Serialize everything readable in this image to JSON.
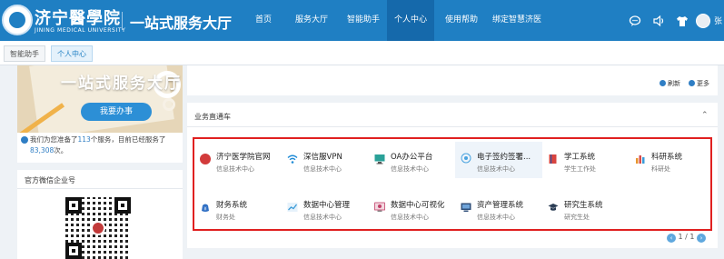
{
  "header": {
    "school_name_cn": "济宁醫學院",
    "school_name_en": "JINING MEDICAL UNIVERSITY",
    "site_title": "一站式服务大厅",
    "nav": [
      {
        "label": "首页"
      },
      {
        "label": "服务大厅"
      },
      {
        "label": "智能助手"
      },
      {
        "label": "个人中心",
        "active": true
      },
      {
        "label": "使用帮助"
      },
      {
        "label": "绑定智慧济医"
      }
    ],
    "icons": [
      "chat-icon",
      "volume-icon",
      "shirt-icon",
      "avatar"
    ],
    "username": "张"
  },
  "tabs": [
    {
      "label": "智能助手"
    },
    {
      "label": "个人中心",
      "active": true
    }
  ],
  "banner": {
    "title": "一站式服务大厅",
    "button": "我要办事"
  },
  "stats": {
    "prefix": "我们为您准备了",
    "services": "113",
    "middle": "个服务，目前已经服务了",
    "served": "83,308",
    "suffix": "次。"
  },
  "wechat": {
    "title": "官方微信企业号"
  },
  "top_card": {
    "refresh": "刷新",
    "more": "更多"
  },
  "panel": {
    "title": "业务直通车",
    "services": [
      {
        "name": "济宁医学院官网",
        "dept": "信息技术中心",
        "icon": "school-icon",
        "color": "#d23b3b"
      },
      {
        "name": "深信服VPN",
        "dept": "信息技术中心",
        "icon": "wifi-icon",
        "color": "#1f8bd6"
      },
      {
        "name": "OA办公平台",
        "dept": "信息技术中心",
        "icon": "monitor-icon",
        "color": "#2aa198"
      },
      {
        "name": "电子签约签署...",
        "dept": "信息技术中心",
        "icon": "sign-icon",
        "color": "#4aa3df"
      },
      {
        "name": "学工系统",
        "dept": "学生工作处",
        "icon": "book-icon",
        "color": "#d8443f"
      },
      {
        "name": "科研系统",
        "dept": "科研处",
        "icon": "bar-icon",
        "color": "#e8952e"
      },
      {
        "name": "财务系统",
        "dept": "财务处",
        "icon": "money-icon",
        "color": "#2f6fc4"
      },
      {
        "name": "数据中心管理",
        "dept": "信息技术中心",
        "icon": "chart-icon",
        "color": "#3a9bd8"
      },
      {
        "name": "数据中心可视化",
        "dept": "信息技术中心",
        "icon": "visual-icon",
        "color": "#c2416a"
      },
      {
        "name": "资产管理系统",
        "dept": "信息技术中心",
        "icon": "asset-icon",
        "color": "#2f4f7a"
      },
      {
        "name": "研究生系统",
        "dept": "研究生处",
        "icon": "cap-icon",
        "color": "#2b3d55"
      }
    ],
    "pager": "1 / 1"
  }
}
